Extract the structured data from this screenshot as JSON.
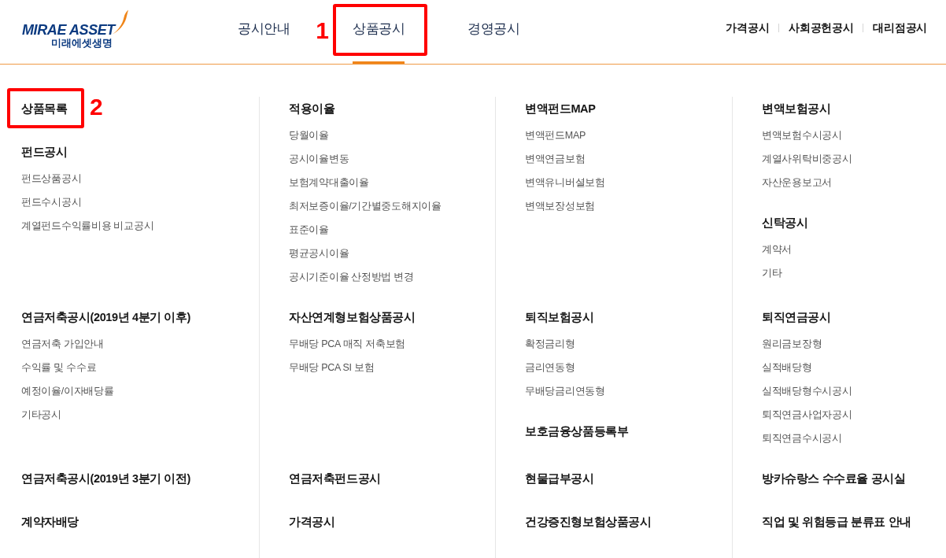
{
  "header": {
    "logo": {
      "wordmark": "MIRAE ASSET",
      "subtitle": "미래에셋생명"
    },
    "nav_tabs": [
      {
        "label": "공시안내",
        "selected": false
      },
      {
        "label": "상품공시",
        "selected": true,
        "annotation": "1"
      },
      {
        "label": "경영공시",
        "selected": false
      }
    ],
    "utility_links": [
      "가격공시",
      "사회공헌공시",
      "대리점공시"
    ]
  },
  "mega_menu": {
    "rows": [
      {
        "cells": [
          {
            "groups": [
              {
                "heading": "상품목록",
                "annotation": "2"
              },
              {
                "heading": "펀드공시",
                "links": [
                  "펀드상품공시",
                  "펀드수시공시",
                  "계열펀드수익률비용 비교공시"
                ]
              }
            ]
          },
          {
            "groups": [
              {
                "heading": "적용이율",
                "links": [
                  "당월이율",
                  "공시이율변동",
                  "보험계약대출이율",
                  "최저보증이율/기간별중도해지이율",
                  "표준이율",
                  "평균공시이율",
                  "공시기준이율 산정방법 변경"
                ]
              }
            ]
          },
          {
            "groups": [
              {
                "heading": "변액펀드MAP",
                "links": [
                  "변액펀드MAP",
                  "변액연금보험",
                  "변액유니버셜보험",
                  "변액보장성보험"
                ]
              }
            ]
          },
          {
            "groups": [
              {
                "heading": "변액보험공시",
                "links": [
                  "변액보험수시공시",
                  "계열사위탁비중공시",
                  "자산운용보고서"
                ]
              },
              {
                "heading": "신탁공시",
                "links": [
                  "계약서",
                  "기타"
                ]
              }
            ]
          }
        ]
      },
      {
        "cells": [
          {
            "groups": [
              {
                "heading": "연금저축공시(2019년 4분기 이후)",
                "links": [
                  "연금저축 가입안내",
                  "수익률 및 수수료",
                  "예정이율/이자배당률",
                  "기타공시"
                ]
              }
            ]
          },
          {
            "groups": [
              {
                "heading": "자산연계형보험상품공시",
                "links": [
                  "무배당 PCA 매직 저축보험",
                  "무배당 PCA SI 보험"
                ]
              }
            ]
          },
          {
            "groups": [
              {
                "heading": "퇴직보험공시",
                "links": [
                  "확정금리형",
                  "금리연동형",
                  "무배당금리연동형"
                ]
              },
              {
                "heading": "보호금융상품등록부"
              }
            ]
          },
          {
            "groups": [
              {
                "heading": "퇴직연금공시",
                "links": [
                  "원리금보장형",
                  "실적배당형",
                  "실적배당형수시공시",
                  "퇴직연금사업자공시",
                  "퇴직연금수시공시"
                ]
              }
            ]
          }
        ]
      },
      {
        "cells": [
          {
            "groups": [
              {
                "heading": "연금저축공시(2019년 3분기 이전)"
              }
            ]
          },
          {
            "groups": [
              {
                "heading": "연금저축펀드공시"
              }
            ]
          },
          {
            "groups": [
              {
                "heading": "현물급부공시"
              }
            ]
          },
          {
            "groups": [
              {
                "heading": "방카슈랑스 수수료율 공시실"
              }
            ]
          }
        ]
      },
      {
        "cells": [
          {
            "groups": [
              {
                "heading": "계약자배당"
              }
            ]
          },
          {
            "groups": [
              {
                "heading": "가격공시"
              }
            ]
          },
          {
            "groups": [
              {
                "heading": "건강증진형보험상품공시"
              }
            ]
          },
          {
            "groups": [
              {
                "heading": "직업 및 위험등급 분류표 안내"
              }
            ]
          }
        ]
      }
    ]
  }
}
